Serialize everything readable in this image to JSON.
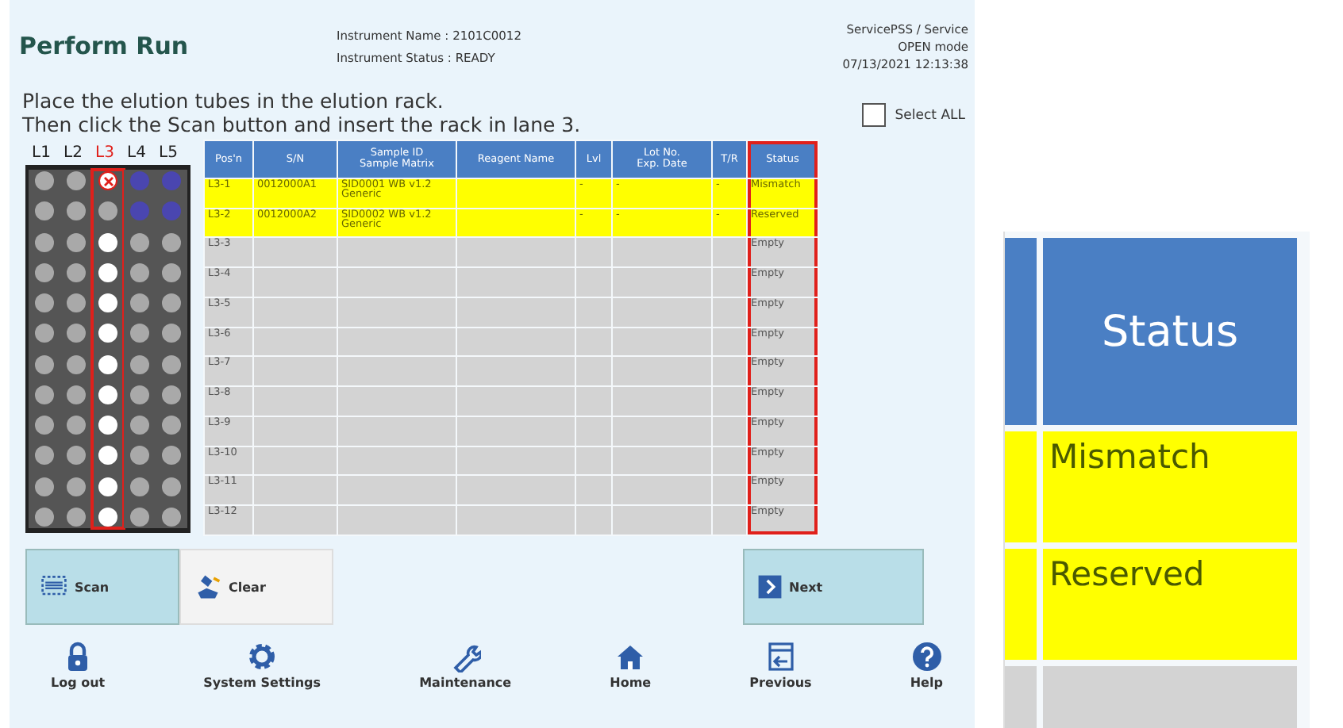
{
  "header": {
    "title": "Perform Run",
    "instrument_name": "Instrument Name : 2101C0012",
    "instrument_status": "Instrument Status : READY",
    "user": "ServicePSS / Service",
    "mode": "OPEN mode",
    "datetime": "07/13/2021 12:13:38"
  },
  "instructions": [
    "Place the elution tubes in the elution rack.",
    "Then click the Scan button and insert the rack in lane 3."
  ],
  "select_all": {
    "label": "Select ALL",
    "checked": false
  },
  "rack": {
    "lanes": [
      {
        "label": "L1",
        "selected": false,
        "tubes": [
          {
            "kind": "empty"
          },
          {
            "kind": "empty"
          },
          {
            "kind": "empty"
          },
          {
            "kind": "empty"
          },
          {
            "kind": "empty"
          },
          {
            "kind": "empty"
          },
          {
            "kind": "empty"
          },
          {
            "kind": "empty"
          },
          {
            "kind": "empty"
          },
          {
            "kind": "empty"
          },
          {
            "kind": "empty"
          },
          {
            "kind": "empty"
          }
        ]
      },
      {
        "label": "L2",
        "selected": false,
        "tubes": [
          {
            "kind": "empty"
          },
          {
            "kind": "empty"
          },
          {
            "kind": "empty"
          },
          {
            "kind": "empty"
          },
          {
            "kind": "empty"
          },
          {
            "kind": "empty"
          },
          {
            "kind": "empty"
          },
          {
            "kind": "empty"
          },
          {
            "kind": "empty"
          },
          {
            "kind": "empty"
          },
          {
            "kind": "empty"
          },
          {
            "kind": "empty"
          }
        ]
      },
      {
        "label": "L3",
        "selected": true,
        "tubes": [
          {
            "kind": "error"
          },
          {
            "kind": "empty"
          },
          {
            "kind": "loaded"
          },
          {
            "kind": "loaded"
          },
          {
            "kind": "loaded"
          },
          {
            "kind": "loaded"
          },
          {
            "kind": "loaded"
          },
          {
            "kind": "loaded"
          },
          {
            "kind": "loaded"
          },
          {
            "kind": "loaded"
          },
          {
            "kind": "loaded"
          },
          {
            "kind": "loaded"
          }
        ]
      },
      {
        "label": "L4",
        "selected": false,
        "tubes": [
          {
            "kind": "occupied"
          },
          {
            "kind": "occupied"
          },
          {
            "kind": "empty"
          },
          {
            "kind": "empty"
          },
          {
            "kind": "empty"
          },
          {
            "kind": "empty"
          },
          {
            "kind": "empty"
          },
          {
            "kind": "empty"
          },
          {
            "kind": "empty"
          },
          {
            "kind": "empty"
          },
          {
            "kind": "empty"
          },
          {
            "kind": "empty"
          }
        ]
      },
      {
        "label": "L5",
        "selected": false,
        "tubes": [
          {
            "kind": "occupied"
          },
          {
            "kind": "occupied"
          },
          {
            "kind": "empty"
          },
          {
            "kind": "empty"
          },
          {
            "kind": "empty"
          },
          {
            "kind": "empty"
          },
          {
            "kind": "empty"
          },
          {
            "kind": "empty"
          },
          {
            "kind": "empty"
          },
          {
            "kind": "empty"
          },
          {
            "kind": "empty"
          },
          {
            "kind": "empty"
          }
        ]
      }
    ]
  },
  "table": {
    "columns": [
      {
        "label": "Pos'n",
        "framed": false
      },
      {
        "label": "S/N",
        "framed": false
      },
      {
        "label": "Sample ID\nSample Matrix",
        "framed": false
      },
      {
        "label": "Reagent Name",
        "framed": false
      },
      {
        "label": "Lvl",
        "framed": false
      },
      {
        "label": "Lot No.\nExp. Date",
        "framed": false
      },
      {
        "label": "T/R",
        "framed": false
      },
      {
        "label": "Status",
        "framed": true
      }
    ],
    "rows": [
      {
        "highlighted": true,
        "pos": "L3-1",
        "sn": "0012000A1",
        "sample": "SID0001 WB v1.2\nGeneric",
        "lvl": "-",
        "lot": "-",
        "tr": "-",
        "status": "Mismatch"
      },
      {
        "highlighted": true,
        "pos": "L3-2",
        "sn": "0012000A2",
        "sample": "SID0002 WB v1.2\nGeneric",
        "lvl": "-",
        "lot": "-",
        "tr": "-",
        "status": "Reserved"
      },
      {
        "highlighted": false,
        "pos": "L3-3",
        "status": "Empty"
      },
      {
        "highlighted": false,
        "pos": "L3-4",
        "status": "Empty"
      },
      {
        "highlighted": false,
        "pos": "L3-5",
        "status": "Empty"
      },
      {
        "highlighted": false,
        "pos": "L3-6",
        "status": "Empty"
      },
      {
        "highlighted": false,
        "pos": "L3-7",
        "status": "Empty"
      },
      {
        "highlighted": false,
        "pos": "L3-8",
        "status": "Empty"
      },
      {
        "highlighted": false,
        "pos": "L3-9",
        "status": "Empty"
      },
      {
        "highlighted": false,
        "pos": "L3-10",
        "status": "Empty"
      },
      {
        "highlighted": false,
        "pos": "L3-11",
        "status": "Empty"
      },
      {
        "highlighted": false,
        "pos": "L3-12",
        "status": "Empty"
      }
    ]
  },
  "actions": [
    {
      "kind": "scan",
      "label": "Scan"
    },
    {
      "kind": "clear",
      "label": "Clear"
    },
    {
      "kind": "next",
      "label": "Next"
    }
  ],
  "nav": [
    {
      "kind": "lock",
      "label": "Log out"
    },
    {
      "kind": "gear",
      "label": "System Settings"
    },
    {
      "kind": "wrench",
      "label": "Maintenance"
    },
    {
      "kind": "home",
      "label": "Home"
    },
    {
      "kind": "previous",
      "label": "Previous"
    },
    {
      "kind": "help",
      "label": "Help"
    }
  ],
  "zoom_inset": {
    "header": "Status",
    "rows": [
      {
        "highlighted": true,
        "status": "Mismatch"
      },
      {
        "highlighted": true,
        "status": "Reserved"
      },
      {
        "highlighted": false
      }
    ]
  }
}
